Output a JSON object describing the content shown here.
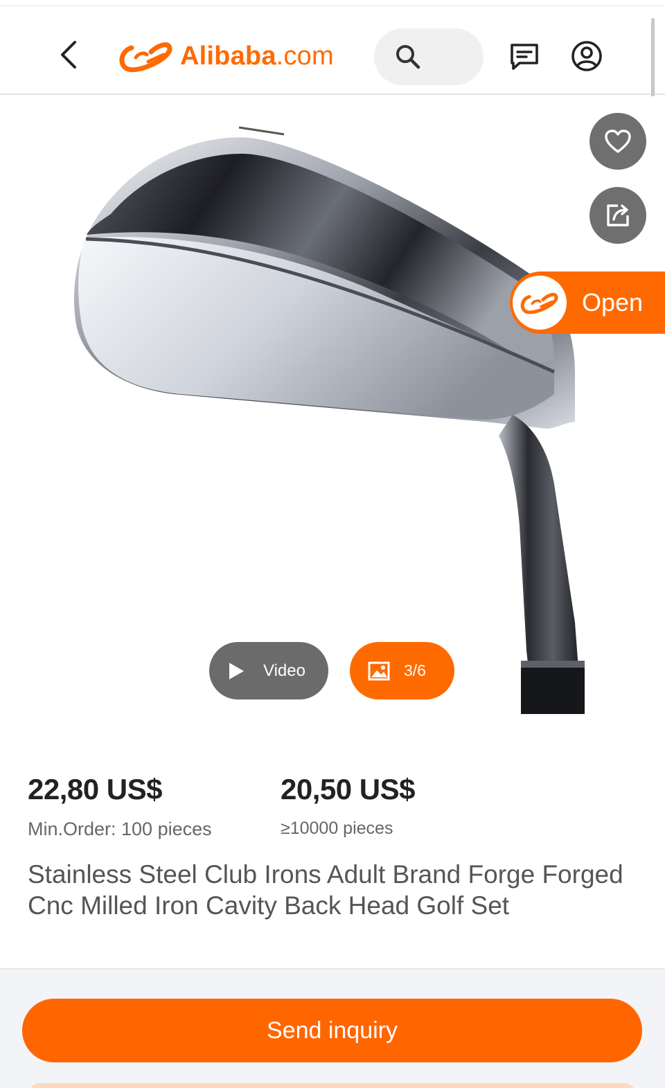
{
  "header": {
    "logo_name": "Alibaba",
    "logo_tld": ".com",
    "icons": {
      "back": "chevron-left-icon",
      "search": "search-icon",
      "messages": "message-icon",
      "account": "user-circle-icon"
    }
  },
  "gallery": {
    "favorite_icon": "heart-icon",
    "share_icon": "share-icon",
    "open_app_label": "Open",
    "video_label": "Video",
    "photo_counter": "3/6"
  },
  "pricing": {
    "tier1_price": "22,80 US$",
    "tier1_min_order": "Min.Order: 100 pieces",
    "tier2_price": "20,50 US$",
    "tier2_quantity": "≥10000 pieces"
  },
  "product": {
    "title": "Stainless Steel Club Irons Adult Brand Forge Forged Cnc Milled Iron Cavity Back Head Golf Set"
  },
  "actions": {
    "send_inquiry": "Send inquiry"
  },
  "colors": {
    "brand_orange": "#ff6a00",
    "icon_button_gray": "#6f6f6f",
    "search_bg": "#f0f0f0"
  }
}
